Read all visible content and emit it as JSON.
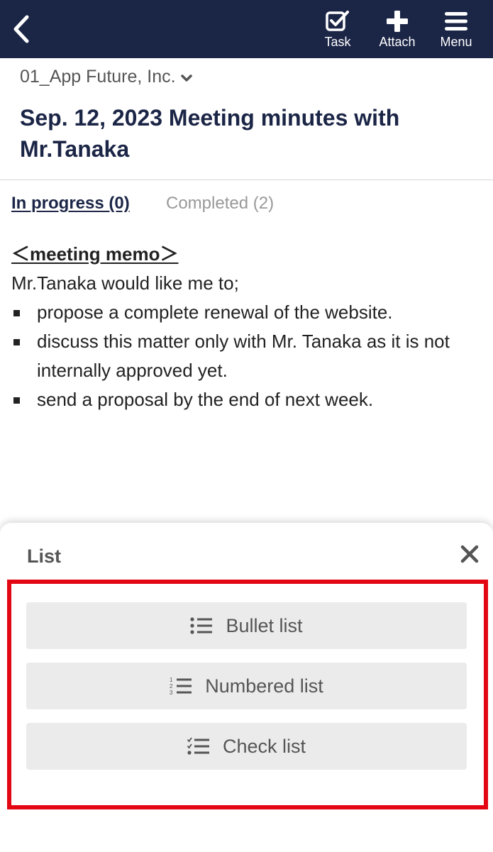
{
  "header": {
    "back_icon": "chevron-left-icon",
    "task": {
      "label": "Task",
      "icon": "checkbox-pen-icon"
    },
    "attach": {
      "label": "Attach",
      "icon": "plus-icon"
    },
    "menu": {
      "label": "Menu",
      "icon": "hamburger-icon"
    },
    "background_color": "#1b2546"
  },
  "company": {
    "name": "01_App Future, Inc.",
    "icon": "chevron-down-icon"
  },
  "page_title": "Sep. 12, 2023 Meeting minutes with Mr.Tanaka",
  "tabs": [
    {
      "label": "In progress (0)",
      "active": true
    },
    {
      "label": "Completed (2)",
      "active": false
    }
  ],
  "memo": {
    "heading": "＜meeting memo＞",
    "intro": "Mr.Tanaka would like me to;",
    "items": [
      "propose a complete renewal of the website.",
      "discuss this matter only with Mr. Tanaka as it is not internally approved yet.",
      "send a proposal by the end of next week."
    ]
  },
  "sheet": {
    "title": "List",
    "close_icon": "close-icon",
    "options": [
      {
        "label": "Bullet list",
        "icon": "bullet-list-icon"
      },
      {
        "label": "Numbered list",
        "icon": "numbered-list-icon"
      },
      {
        "label": "Check list",
        "icon": "check-list-icon"
      }
    ],
    "highlight_color": "#e30613"
  }
}
